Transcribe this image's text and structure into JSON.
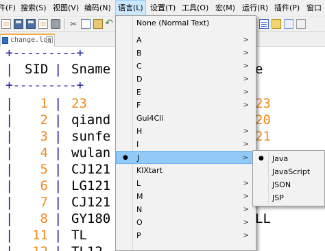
{
  "menubar": {
    "items": [
      "件(F)",
      "搜索(S)",
      "视图(V)",
      "编码(N)",
      "语言(L)",
      "设置(T)",
      "工具(O)",
      "宏(M)",
      "运行(R)",
      "插件(P)",
      "窗口"
    ],
    "active": "语言(L)"
  },
  "toolbar": {
    "icons": [
      "new-file-icon",
      "open-file-icon",
      "save-icon",
      "save-all-icon",
      "close-icon",
      "print-icon",
      "cut-icon",
      "copy-icon",
      "paste-icon",
      "undo-icon",
      "word-wrap-icon",
      "bookmark-icon",
      "doc-map-icon",
      "panel-icon"
    ]
  },
  "tabs": [
    {
      "label": "change.log",
      "close": "×"
    }
  ],
  "editor": {
    "border_line": "+---------+",
    "header": {
      "pipe": "|",
      "sid": "SID",
      "sname": "Sname",
      "tail": "e"
    },
    "rows": [
      {
        "pipe": "|",
        "sid": "1",
        "sname": "23",
        "sname_numeric": true,
        "tail": "23",
        "tail_numeric": true
      },
      {
        "pipe": "|",
        "sid": "2",
        "sname": "qiand",
        "sname_numeric": false,
        "tail": "20",
        "tail_numeric": true
      },
      {
        "pipe": "|",
        "sid": "3",
        "sname": "sunfe",
        "sname_numeric": false,
        "tail": "21",
        "tail_numeric": true
      },
      {
        "pipe": "|",
        "sid": "4",
        "sname": "wulan",
        "sname_numeric": false,
        "tail": "",
        "tail_numeric": true
      },
      {
        "pipe": "|",
        "sid": "5",
        "sname": "CJ121",
        "sname_numeric": false,
        "tail": "",
        "tail_numeric": true
      },
      {
        "pipe": "|",
        "sid": "6",
        "sname": "LG121",
        "sname_numeric": false,
        "tail": "",
        "tail_numeric": true
      },
      {
        "pipe": "|",
        "sid": "7",
        "sname": "CJ121",
        "sname_numeric": false,
        "tail": "",
        "tail_numeric": true
      },
      {
        "pipe": "|",
        "sid": "8",
        "sname": "GY180",
        "sname_numeric": false,
        "tail": "LL",
        "tail_numeric": false
      },
      {
        "pipe": "|",
        "sid": "11",
        "sname": "TL",
        "sname_numeric": false,
        "tail": "",
        "tail_numeric": true
      },
      {
        "pipe": "|",
        "sid": "12",
        "sname": "TL12",
        "sname_numeric": false,
        "tail": "",
        "tail_numeric": true
      }
    ]
  },
  "language_menu": {
    "items": [
      {
        "label": "None (Normal Text)",
        "submenu": false,
        "selected": false
      },
      {
        "label": "A",
        "submenu": true,
        "selected": false
      },
      {
        "label": "B",
        "submenu": true,
        "selected": false
      },
      {
        "label": "C",
        "submenu": true,
        "selected": false
      },
      {
        "label": "D",
        "submenu": true,
        "selected": false
      },
      {
        "label": "E",
        "submenu": true,
        "selected": false
      },
      {
        "label": "F",
        "submenu": true,
        "selected": false
      },
      {
        "label": "Gui4Cli",
        "submenu": false,
        "selected": false
      },
      {
        "label": "H",
        "submenu": true,
        "selected": false
      },
      {
        "label": "I",
        "submenu": true,
        "selected": false
      },
      {
        "label": "J",
        "submenu": true,
        "selected": true
      },
      {
        "label": "KIXtart",
        "submenu": false,
        "selected": false
      },
      {
        "label": "L",
        "submenu": true,
        "selected": false
      },
      {
        "label": "M",
        "submenu": true,
        "selected": false
      },
      {
        "label": "N",
        "submenu": true,
        "selected": false
      },
      {
        "label": "O",
        "submenu": true,
        "selected": false
      },
      {
        "label": "P",
        "submenu": true,
        "selected": false
      }
    ],
    "bullet": "●",
    "arrow": ">"
  },
  "j_submenu": {
    "items": [
      {
        "label": "Java",
        "selected": true
      },
      {
        "label": "JavaScript",
        "selected": false
      },
      {
        "label": "JSON",
        "selected": false
      },
      {
        "label": "JSP",
        "selected": false
      }
    ],
    "bullet": "●"
  },
  "colors": {
    "menu_highlight": "#91c9f7",
    "numeric_text": "#f08a1d",
    "table_border": "#1a1aa6"
  }
}
